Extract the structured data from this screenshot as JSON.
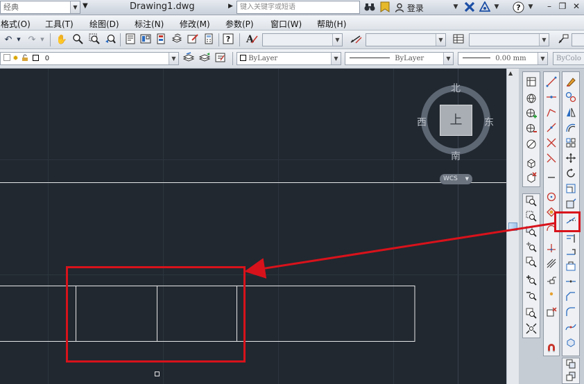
{
  "titlebar": {
    "workspace": "经典",
    "document_title": "Drawing1.dwg",
    "search_placeholder": "键入关键字或短语",
    "login": "登录"
  },
  "menu": {
    "items": [
      "格式(O)",
      "工具(T)",
      "绘图(D)",
      "标注(N)",
      "修改(M)",
      "参数(P)",
      "窗口(W)",
      "帮助(H)"
    ]
  },
  "layers": {
    "current_layer": "0"
  },
  "properties": {
    "color": "ByLayer",
    "linetype": "ByLayer",
    "lineweight": "0.00 mm",
    "plotstyle": "ByColo"
  },
  "viewcube": {
    "north": "北",
    "south": "南",
    "east": "东",
    "west": "西",
    "face": "上",
    "wcs": "WCS"
  },
  "colors": {
    "canvas": "#212830",
    "highlight": "#d8121b",
    "geometry": "#ffffff"
  }
}
